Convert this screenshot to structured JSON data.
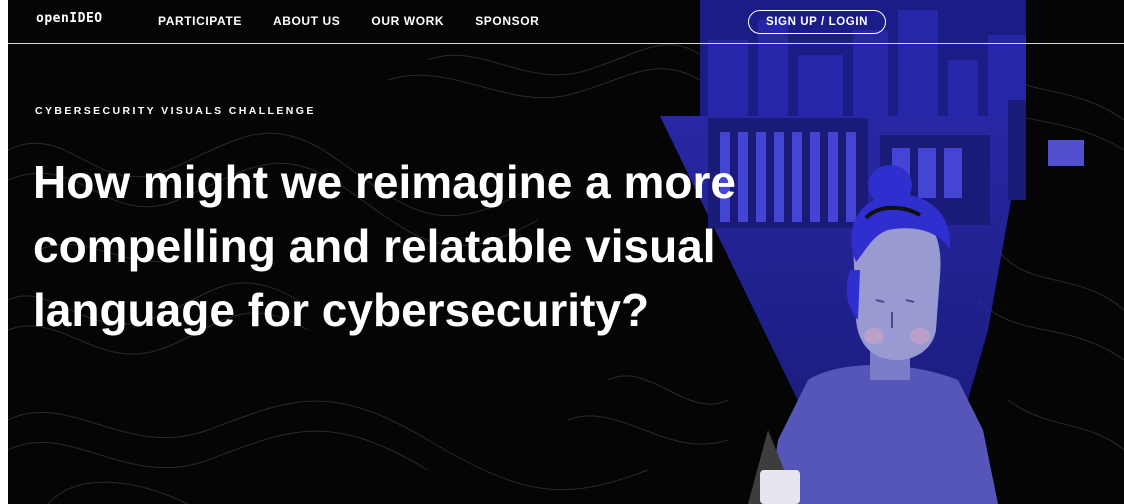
{
  "nav": {
    "logo": "openIDEO",
    "links": [
      {
        "label": "PARTICIPATE"
      },
      {
        "label": "ABOUT US"
      },
      {
        "label": "OUR WORK"
      },
      {
        "label": "SPONSOR"
      }
    ],
    "signup_label": "SIGN UP / LOGIN"
  },
  "hero": {
    "eyebrow": "CYBERSECURITY VISUALS CHALLENGE",
    "headline": "How might we reimagine a more compelling and relatable visual language for cybersecurity?"
  },
  "colors": {
    "background": "#050505",
    "accent_blue": "#2b2bd6",
    "text": "#ffffff"
  },
  "illustration": {
    "subject": "person-looking-at-phone-with-city-beam"
  }
}
